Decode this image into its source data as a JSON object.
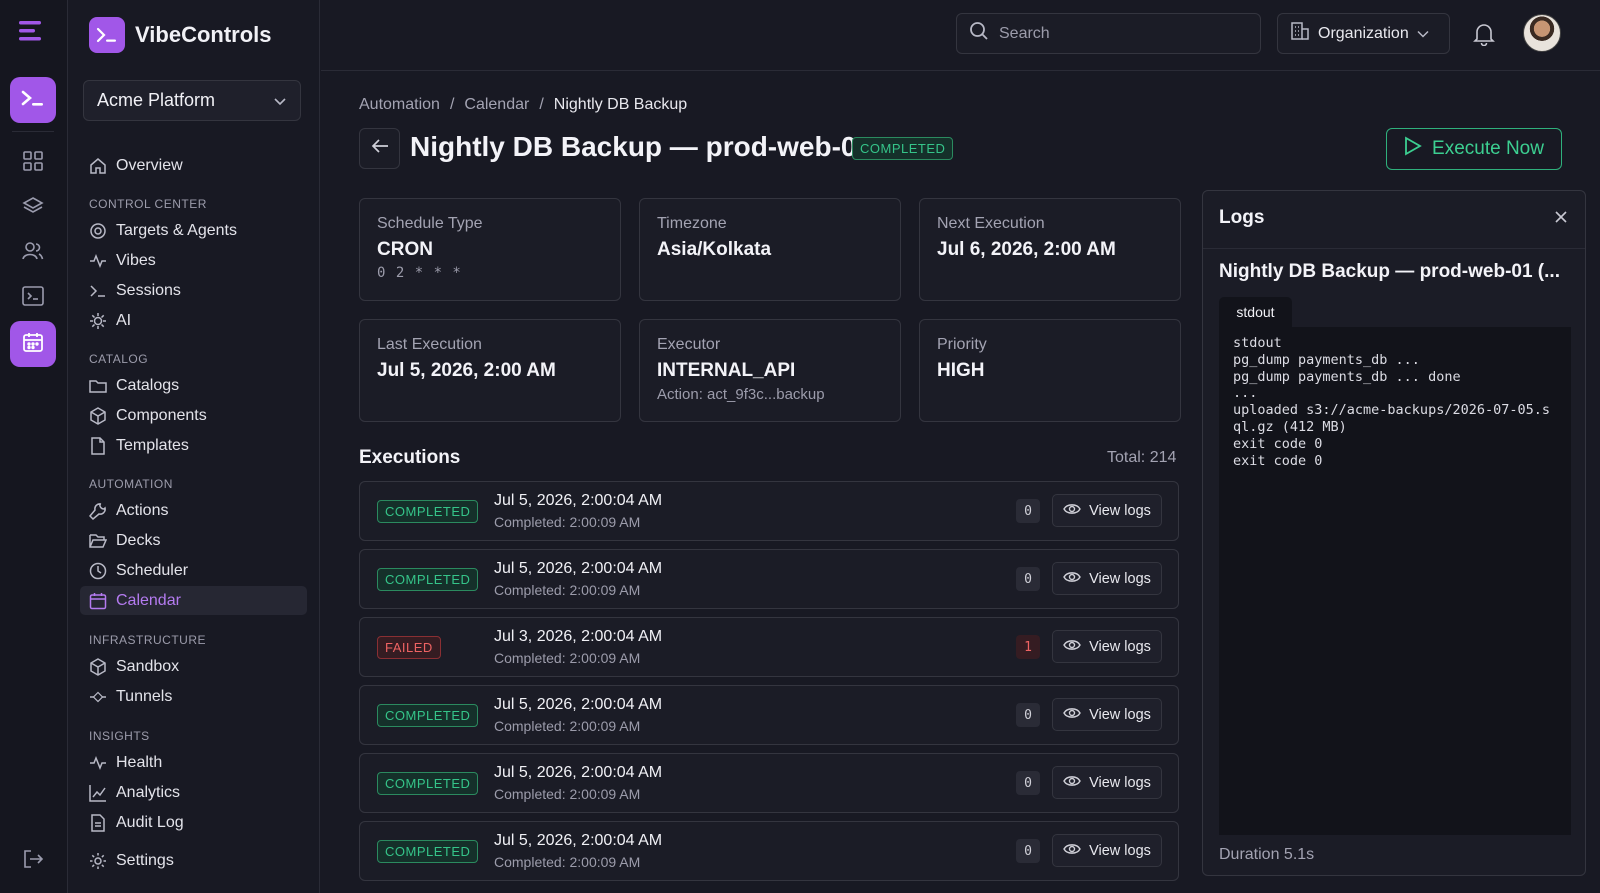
{
  "app": {
    "name": "VibeControls",
    "project": "Acme Platform"
  },
  "rail": {
    "items": [
      "menu-icon",
      "terminal-icon",
      "grid-icon",
      "layers-icon",
      "users-icon",
      "console-icon",
      "calendar-icon",
      "logout-icon"
    ]
  },
  "sidebar": {
    "overview": "Overview",
    "sections": {
      "control_center": "CONTROL CENTER",
      "catalog": "CATALOG",
      "automation": "AUTOMATION",
      "infrastructure": "INFRASTRUCTURE",
      "insights": "INSIGHTS"
    },
    "items": {
      "targets": "Targets & Agents",
      "vibes": "Vibes",
      "sessions": "Sessions",
      "ai": "AI",
      "catalogs": "Catalogs",
      "components": "Components",
      "templates": "Templates",
      "actions": "Actions",
      "decks": "Decks",
      "scheduler": "Scheduler",
      "calendar": "Calendar",
      "sandbox": "Sandbox",
      "tunnels": "Tunnels",
      "health": "Health",
      "analytics": "Analytics",
      "audit_log": "Audit Log",
      "settings": "Settings"
    }
  },
  "topbar": {
    "search_placeholder": "Search",
    "org_label": "Organization"
  },
  "breadcrumb": [
    "Automation",
    "Calendar",
    "Nightly DB Backup"
  ],
  "page": {
    "title": "Nightly DB Backup — prod-web-01",
    "status": "COMPLETED",
    "execute_label": "Execute Now"
  },
  "cards": {
    "schedule_type": {
      "label": "Schedule Type",
      "value": "CRON",
      "sub": "0 2 * * *"
    },
    "timezone": {
      "label": "Timezone",
      "value": "Asia/Kolkata"
    },
    "next_execution": {
      "label": "Next Execution",
      "value": "Jul 6, 2026, 2:00 AM"
    },
    "last_execution": {
      "label": "Last Execution",
      "value": "Jul 5, 2026, 2:00 AM"
    },
    "executor": {
      "label": "Executor",
      "value": "INTERNAL_API",
      "sub": "Action: act_9f3c...backup"
    },
    "priority": {
      "label": "Priority",
      "value": "HIGH"
    }
  },
  "executions": {
    "heading": "Executions",
    "total": "Total: 214",
    "view_logs_label": "View logs",
    "rows": [
      {
        "status": "COMPLETED",
        "started": "Jul 5, 2026, 2:00:04 AM",
        "completed": "Completed: 2:00:09 AM",
        "exit_code": "0"
      },
      {
        "status": "COMPLETED",
        "started": "Jul 5, 2026, 2:00:04 AM",
        "completed": "Completed: 2:00:09 AM",
        "exit_code": "0"
      },
      {
        "status": "FAILED",
        "started": "Jul 3, 2026, 2:00:04 AM",
        "completed": "Completed: 2:00:09 AM",
        "exit_code": "1"
      },
      {
        "status": "COMPLETED",
        "started": "Jul 5, 2026, 2:00:04 AM",
        "completed": "Completed: 2:00:09 AM",
        "exit_code": "0"
      },
      {
        "status": "COMPLETED",
        "started": "Jul 5, 2026, 2:00:04 AM",
        "completed": "Completed: 2:00:09 AM",
        "exit_code": "0"
      },
      {
        "status": "COMPLETED",
        "started": "Jul 5, 2026, 2:00:04 AM",
        "completed": "Completed: 2:00:09 AM",
        "exit_code": "0"
      }
    ]
  },
  "logs": {
    "title": "Logs",
    "subtitle": "Nightly DB Backup — prod-web-01 (...",
    "tab": "stdout",
    "output": "stdout\npg_dump payments_db ...\npg_dump payments_db ... done\n...\nuploaded s3://acme-backups/2026-07-05.sql.gz (412 MB)\nexit code 0\nexit code 0",
    "duration": "Duration 5.1s"
  },
  "colors": {
    "accent": "#a157e8",
    "success": "#35c489",
    "danger": "#ef6363",
    "background": "#181923"
  }
}
